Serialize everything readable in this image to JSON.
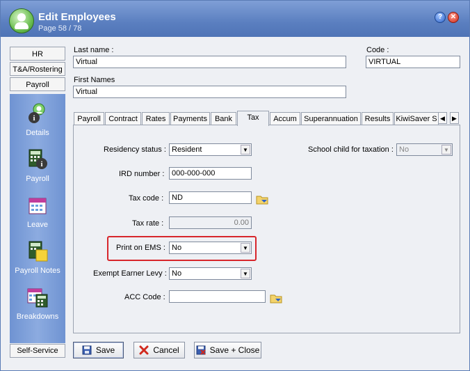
{
  "window": {
    "title": "Edit Employees",
    "subtitle": "Page 58 / 78"
  },
  "sidebar": {
    "tabs": [
      "HR",
      "T&A/Rostering",
      "Payroll"
    ],
    "items": [
      {
        "label": "Details",
        "icon": "person-info-icon"
      },
      {
        "label": "Payroll",
        "icon": "calculator-info-icon"
      },
      {
        "label": "Leave",
        "icon": "calendar-icon"
      },
      {
        "label": "Payroll Notes",
        "icon": "calculator-note-icon"
      },
      {
        "label": "Breakdowns",
        "icon": "calendar-calculator-icon"
      }
    ],
    "bottom_tab": "Self-Service"
  },
  "fields": {
    "last_name": {
      "label": "Last name :",
      "value": "Virtual"
    },
    "first_names": {
      "label": "First Names",
      "value": "Virtual"
    },
    "code": {
      "label": "Code :",
      "value": "VIRTUAL"
    }
  },
  "tabs": [
    "Payroll",
    "Contract",
    "Rates",
    "Payments",
    "Bank",
    "Tax",
    "Accum",
    "Superannuation",
    "Results",
    "KiwiSaver S"
  ],
  "active_tab": "Tax",
  "tax": {
    "residency_status": {
      "label": "Residency status :",
      "value": "Resident"
    },
    "school_child": {
      "label": "School child for taxation :",
      "value": "No"
    },
    "ird_number": {
      "label": "IRD number :",
      "value": "000-000-000"
    },
    "tax_code": {
      "label": "Tax code :",
      "value": "ND"
    },
    "tax_rate": {
      "label": "Tax rate :",
      "value": "0.00"
    },
    "print_on_ems": {
      "label": "Print on EMS :",
      "value": "No"
    },
    "exempt_earner_levy": {
      "label": "Exempt Earner Levy :",
      "value": "No"
    },
    "acc_code": {
      "label": "ACC Code :",
      "value": ""
    }
  },
  "buttons": {
    "save": "Save",
    "cancel": "Cancel",
    "save_close": "Save + Close"
  },
  "colors": {
    "highlight": "#d7262b",
    "titlebar": "#5b7fc0",
    "sidebar": "#7a9ad6"
  }
}
